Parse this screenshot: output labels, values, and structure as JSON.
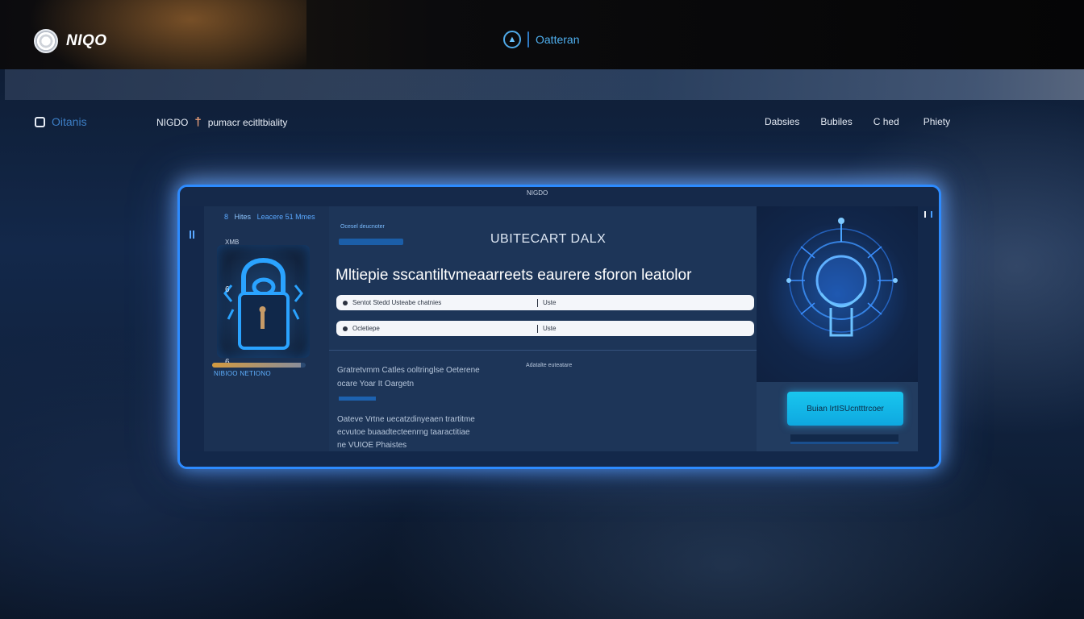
{
  "header": {
    "brand_name": "NIQO",
    "logo_icon": "brain-logo-icon",
    "center_label": "Oatteran",
    "center_icon": "shield-icon"
  },
  "nav": {
    "left_label": "Oitanis",
    "search_prefix": "NIGDO",
    "search_text": "pumacr ecitltbiality",
    "links": [
      "Dabsies",
      "Bubiles",
      "C hed",
      "Phiety"
    ]
  },
  "panel": {
    "title": "NIGDO",
    "breadcrumb_a": "8",
    "breadcrumb_b": "Hites",
    "breadcrumb_c": "Leacere 51 Mmes",
    "side_tag": "XMB",
    "lock_mark_a": "6",
    "lock_mark_b": "6",
    "side_progress": 0.95,
    "side_status": "NIBIOO NETIONO",
    "chip_label": "Ocesel deucnoter",
    "content_title": "UBITECART DALX",
    "headline": "Mltiepie sscantiltvmeaarreets eaurere sforon leatolor",
    "input1_text": "Sentot Stedd Usteabe chatnies",
    "input1_right": "Uste",
    "input2_text": "Ocletiepe",
    "input2_right": "Uste",
    "info_a_line1": "Gratretvmm  Catles ooltringlse Oeterene",
    "info_a_line2": "ocare Yoar It Oargetn",
    "info_a_side": "Adatalte euteatare",
    "info_b_line1": "Oateve Vrtne  uecatzdinyeaen trartitme",
    "info_b_line2": "ecvutoe buaadtecteenrng taaractitiae",
    "info_b_line3": "ne VUIOE Phaistes",
    "cta_label": "Buian IrtISUcntttrcoer"
  },
  "colors": {
    "accent": "#2d8bff",
    "cta": "#19c6ee",
    "panel_bg": "#1d3558"
  }
}
